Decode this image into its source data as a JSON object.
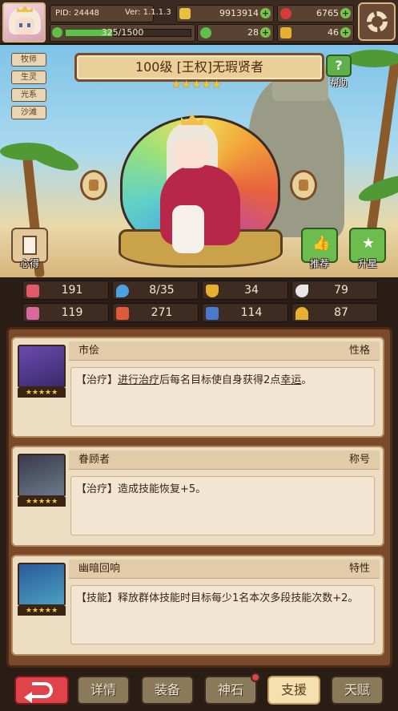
{
  "topbar": {
    "pid": "PID: 24448",
    "version": "Ver: 1.1.1.3",
    "gold": "9913914",
    "gems": "6765",
    "exp": "325/1500",
    "clover": "28",
    "item": "46"
  },
  "tags": [
    "牧师",
    "生灵",
    "光系",
    "沙滩"
  ],
  "hero": {
    "title": "100级 [王权]无瑕贤者",
    "stars": "★★★★★"
  },
  "buttons": {
    "help": "帮助",
    "xinde": "心得",
    "tuijian": "推荐",
    "shengxing": "升星"
  },
  "stats": [
    {
      "icon": "heart-icon",
      "value": "191",
      "color": "#e05a6a"
    },
    {
      "icon": "drop-icon",
      "value": "8/35",
      "color": "#4aa3e0"
    },
    {
      "icon": "shield-icon",
      "value": "34",
      "color": "#e8b030"
    },
    {
      "icon": "wing-icon",
      "value": "79",
      "color": "#e8e8e8"
    },
    {
      "icon": "spellbook-icon",
      "value": "119",
      "color": "#d86a9a"
    },
    {
      "icon": "book-icon",
      "value": "271",
      "color": "#e05a3a"
    },
    {
      "icon": "boot-icon",
      "value": "114",
      "color": "#4a7ad0"
    },
    {
      "icon": "horseshoe-icon",
      "value": "87",
      "color": "#e8b030"
    }
  ],
  "cards": [
    {
      "name": "市侩",
      "type": "性格",
      "stars": "★★★★★",
      "desc_prefix": "【治疗】",
      "desc_link1": "进行治疗",
      "desc_mid": "后每名目标使自身获得2点",
      "desc_link2": "幸运",
      "desc_suffix": "。"
    },
    {
      "name": "眷顾者",
      "type": "称号",
      "stars": "★★★★★",
      "desc": "【治疗】造成技能恢复+5。"
    },
    {
      "name": "幽暗回响",
      "type": "特性",
      "stars": "★★★★★",
      "desc": "【技能】释放群体技能时目标每少1名本次多段技能次数+2。"
    }
  ],
  "nav": [
    "详情",
    "装备",
    "神石",
    "支援",
    "天赋"
  ],
  "nav_active": "支援"
}
